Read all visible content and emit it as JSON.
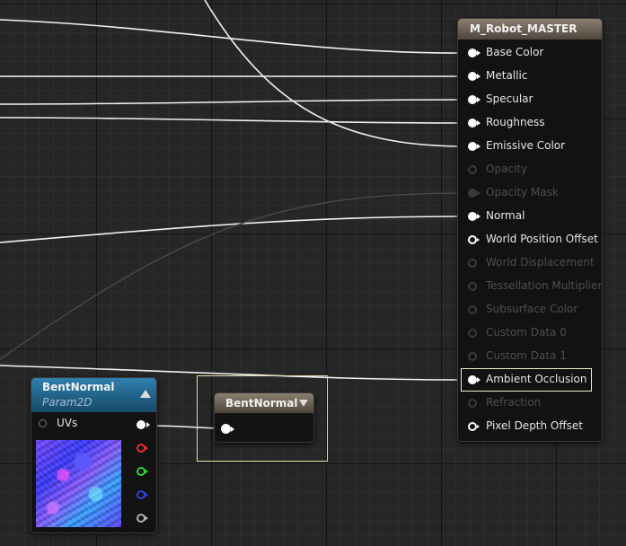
{
  "material_node": {
    "title": "M_Robot_MASTER",
    "highlighted_pin": "Ambient Occlusion",
    "pins": [
      {
        "label": "Base Color",
        "enabled": true,
        "connected": true
      },
      {
        "label": "Metallic",
        "enabled": true,
        "connected": true
      },
      {
        "label": "Specular",
        "enabled": true,
        "connected": true
      },
      {
        "label": "Roughness",
        "enabled": true,
        "connected": true
      },
      {
        "label": "Emissive Color",
        "enabled": true,
        "connected": true
      },
      {
        "label": "Opacity",
        "enabled": false,
        "connected": false
      },
      {
        "label": "Opacity Mask",
        "enabled": false,
        "connected": true
      },
      {
        "label": "Normal",
        "enabled": true,
        "connected": true
      },
      {
        "label": "World Position Offset",
        "enabled": true,
        "connected": false
      },
      {
        "label": "World Displacement",
        "enabled": false,
        "connected": false
      },
      {
        "label": "Tessellation Multiplier",
        "enabled": false,
        "connected": false
      },
      {
        "label": "Subsurface Color",
        "enabled": false,
        "connected": false
      },
      {
        "label": "Custom Data 0",
        "enabled": false,
        "connected": false
      },
      {
        "label": "Custom Data 1",
        "enabled": false,
        "connected": false
      },
      {
        "label": "Ambient Occlusion",
        "enabled": true,
        "connected": true
      },
      {
        "label": "Refraction",
        "enabled": false,
        "connected": false
      },
      {
        "label": "Pixel Depth Offset",
        "enabled": true,
        "connected": false
      }
    ]
  },
  "texture_node": {
    "title": "BentNormal",
    "subtitle": "Param2D",
    "input_label": "UVs",
    "outputs": [
      {
        "channel": "rgb",
        "color": "#ffffff"
      },
      {
        "channel": "r",
        "color": "#e03030"
      },
      {
        "channel": "g",
        "color": "#30d030"
      },
      {
        "channel": "b",
        "color": "#3040e0"
      },
      {
        "channel": "a",
        "color": "#b0b0b0"
      }
    ]
  },
  "named_node": {
    "title": "BentNormal"
  },
  "colors": {
    "wire": "#ffffff",
    "wire_disabled": "#4a4a4a",
    "graph_background": "#262626",
    "selection": "#e8d9a3"
  }
}
